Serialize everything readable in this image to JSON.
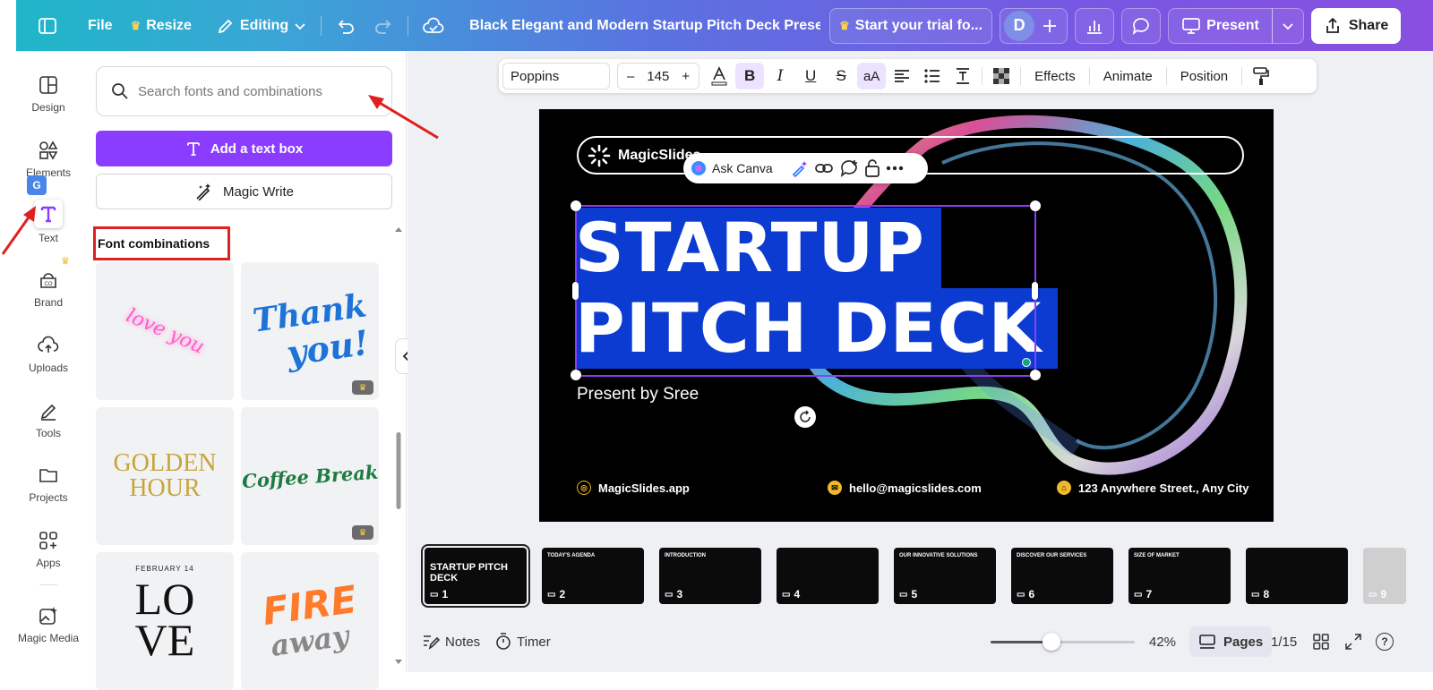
{
  "topbar": {
    "file": "File",
    "resize": "Resize",
    "editing": "Editing",
    "title": "Black Elegant and Modern Startup Pitch Deck Presen...",
    "trial": "Start your trial fo...",
    "avatar": "D",
    "present": "Present",
    "share": "Share"
  },
  "rail": {
    "design": "Design",
    "elements": "Elements",
    "text": "Text",
    "brand": "Brand",
    "uploads": "Uploads",
    "tools": "Tools",
    "projects": "Projects",
    "apps": "Apps",
    "magic_media": "Magic Media"
  },
  "panel": {
    "search_placeholder": "Search fonts and combinations",
    "add_text_box": "Add a text box",
    "magic_write": "Magic Write",
    "font_combinations": "Font combinations",
    "tiles": {
      "love_you": "love you",
      "thank_you_1": "Thank",
      "thank_you_2": "you!",
      "golden_1": "GOLDEN",
      "golden_2": "HOUR",
      "coffee": "Coffee Break",
      "feb": "FEBRUARY 14",
      "love_1": "LO",
      "love_2": "VE",
      "fire_1": "FIRE",
      "fire_2": "away"
    }
  },
  "toolbar": {
    "font": "Poppins",
    "minus": "–",
    "size": "145",
    "plus": "+",
    "effects": "Effects",
    "animate": "Animate",
    "position": "Position"
  },
  "slide": {
    "brand": "MagicSlides",
    "line1": "STARTUP",
    "line2": "PITCH DECK",
    "subtitle": "Present by Sree",
    "website": "MagicSlides.app",
    "email": "hello@magicslides.com",
    "address": "123 Anywhere Street., Any City",
    "ask_canva": "Ask Canva"
  },
  "thumbs": [
    {
      "n": "1",
      "t": "STARTUP PITCH DECK"
    },
    {
      "n": "2",
      "t": "TODAY'S AGENDA"
    },
    {
      "n": "3",
      "t": "INTRODUCTION"
    },
    {
      "n": "4",
      "t": ""
    },
    {
      "n": "5",
      "t": "OUR INNOVATIVE SOLUTIONS"
    },
    {
      "n": "6",
      "t": "DISCOVER OUR SERVICES"
    },
    {
      "n": "7",
      "t": "SIZE OF MARKET"
    },
    {
      "n": "8",
      "t": ""
    },
    {
      "n": "9",
      "t": ""
    }
  ],
  "bottombar": {
    "notes": "Notes",
    "timer": "Timer",
    "zoom": "42%",
    "zoom_fraction": 0.42,
    "pages": "Pages",
    "page_count": "1/15",
    "help": "?"
  },
  "colors": {
    "accent_purple": "#8b3dff",
    "highlight_blue": "#0b3bd0",
    "annotation_red": "#e02020"
  }
}
